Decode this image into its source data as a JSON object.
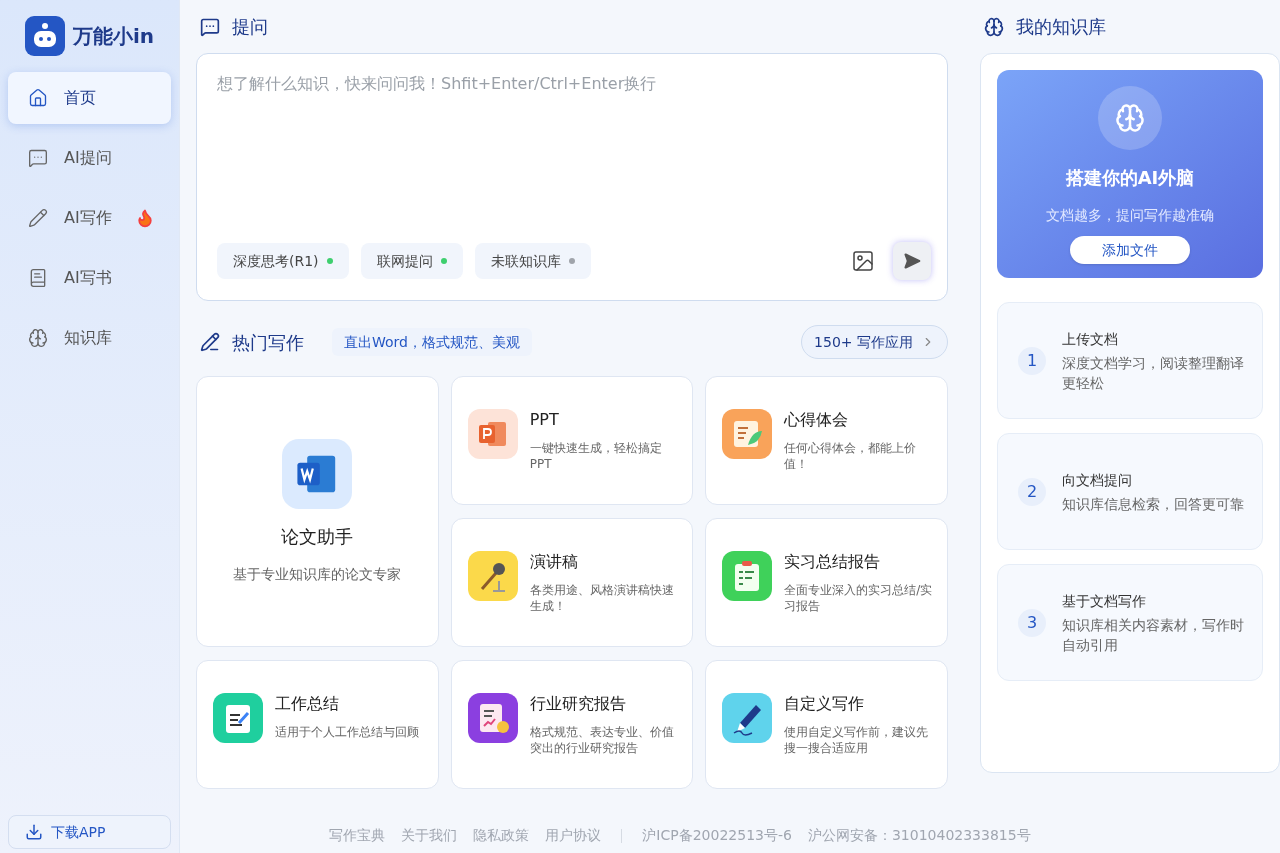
{
  "brand": "万能小in",
  "nav": [
    {
      "label": "首页",
      "kind": "home",
      "selected": true,
      "hot": false
    },
    {
      "label": "AI提问",
      "kind": "chat",
      "selected": false,
      "hot": false
    },
    {
      "label": "AI写作",
      "kind": "pen",
      "selected": false,
      "hot": true
    },
    {
      "label": "AI写书",
      "kind": "book",
      "selected": false,
      "hot": false
    },
    {
      "label": "知识库",
      "kind": "brain",
      "selected": false,
      "hot": false
    }
  ],
  "download": "下载APP",
  "ask": {
    "title": "提问",
    "placeholder": "想了解什么知识，快来问问我！Shfit+Enter/Ctrl+Enter换行",
    "chips": [
      {
        "label": "深度思考(R1)",
        "on": true
      },
      {
        "label": "联网提问",
        "on": true
      },
      {
        "label": "未联知识库",
        "on": false
      }
    ]
  },
  "hot": {
    "title": "热门写作",
    "tagline": "直出Word，格式规范、美观",
    "more": "150+ 写作应用",
    "featured": {
      "title": "论文助手",
      "desc": "基于专业知识库的论文专家",
      "kind": "word"
    },
    "cards": [
      {
        "title": "PPT",
        "desc": "一键快速生成，轻松搞定PPT",
        "kind": "ppt"
      },
      {
        "title": "心得体会",
        "desc": "任何心得体会，都能上价值！",
        "kind": "scroll"
      },
      {
        "title": "演讲稿",
        "desc": "各类用途、风格演讲稿快速生成！",
        "kind": "mic"
      },
      {
        "title": "实习总结报告",
        "desc": "全面专业深入的实习总结/实习报告",
        "kind": "clipboard"
      },
      {
        "title": "工作总结",
        "desc": "适用于个人工作总结与回顾",
        "kind": "note"
      },
      {
        "title": "行业研究报告",
        "desc": "格式规范、表达专业、价值突出的行业研究报告",
        "kind": "report"
      },
      {
        "title": "自定义写作",
        "desc": "使用自定义写作前，建议先搜一搜合适应用",
        "kind": "pen"
      }
    ]
  },
  "knowledge": {
    "title": "我的知识库",
    "banner_title": "搭建你的AI外脑",
    "banner_sub": "文档越多，提问写作越准确",
    "add": "添加文件",
    "steps": [
      {
        "num": "1",
        "title": "上传文档",
        "desc": "深度文档学习，阅读整理翻译更轻松"
      },
      {
        "num": "2",
        "title": "向文档提问",
        "desc": "知识库信息检索，回答更可靠"
      },
      {
        "num": "3",
        "title": "基于文档写作",
        "desc": "知识库相关内容素材，写作时自动引用"
      }
    ]
  },
  "footer": {
    "links": [
      "写作宝典",
      "关于我们",
      "隐私政策",
      "用户协议"
    ],
    "records": [
      "沪ICP备20022513号-6",
      "沪公网安备：31010402333815号"
    ]
  }
}
